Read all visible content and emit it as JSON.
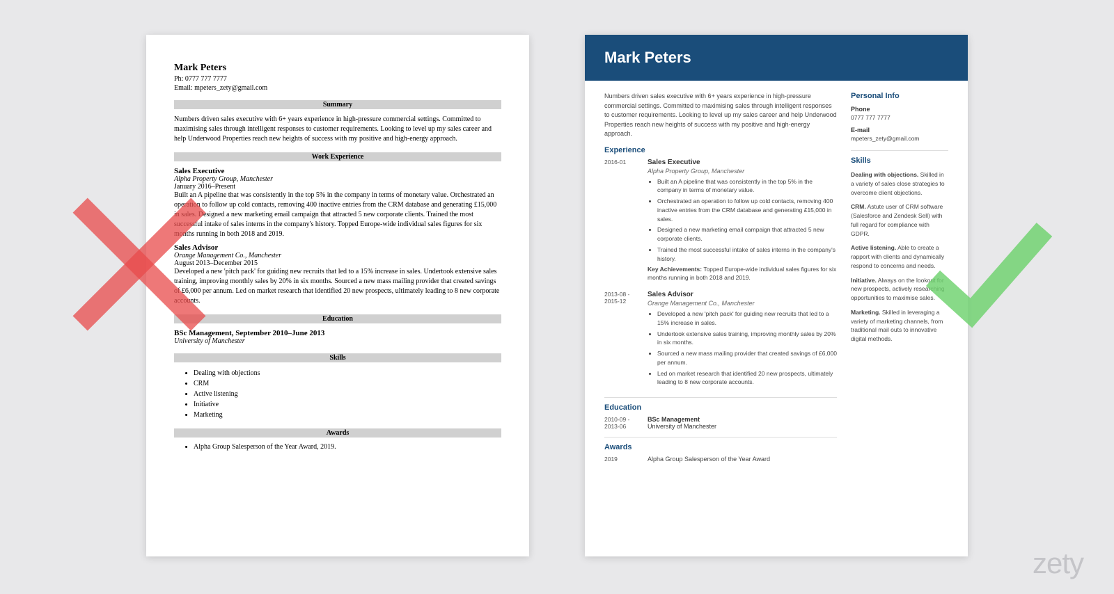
{
  "left": {
    "name": "Mark Peters",
    "phone_label": "Ph: 0777 777 7777",
    "email_label": "Email: mpeters_zety@gmail.com",
    "sections": {
      "summary": "Summary",
      "work": "Work Experience",
      "education": "Education",
      "skills": "Skills",
      "awards": "Awards"
    },
    "summary_text": "Numbers driven sales executive with 6+ years experience in high-pressure commercial settings. Committed to maximising sales through intelligent responses to customer requirements. Looking to level up my sales career and help Underwood Properties reach new heights of success with my positive and high-energy approach.",
    "jobs": [
      {
        "title": "Sales Executive",
        "company": "Alpha Property Group, Manchester",
        "dates": "January 2016–Present",
        "body": "Built an A pipeline that was consistently in the top 5% in the company in terms of monetary value. Orchestrated an operation to follow up cold contacts, removing 400 inactive entries from the CRM database and generating £15,000 in sales. Designed a new marketing email campaign that attracted 5 new corporate clients. Trained the most successful intake of sales interns in the company's history. Topped Europe-wide individual sales figures for six months running in both 2018 and 2019."
      },
      {
        "title": "Sales Advisor",
        "company": "Orange Management Co., Manchester",
        "dates": "August 2013–December 2015",
        "body": "Developed a new 'pitch pack' for guiding new recruits that led to a 15% increase in sales. Undertook extensive sales training, improving monthly sales by 20% in six months. Sourced a new mass mailing provider that created savings of £6,000 per annum. Led on market research that identified 20 new prospects, ultimately leading to 8 new corporate accounts."
      }
    ],
    "education": {
      "title": "BSc Management, September 2010–June 2013",
      "university": "University of Manchester"
    },
    "skills": [
      "Dealing with objections",
      "CRM",
      "Active listening",
      "Initiative",
      "Marketing"
    ],
    "awards": [
      "Alpha Group Salesperson of the Year Award, 2019."
    ]
  },
  "right": {
    "name": "Mark Peters",
    "summary": "Numbers driven sales executive with 6+ years experience in high-pressure commercial settings. Committed to maximising sales through intelligent responses to customer requirements. Looking to level up my sales career and help Underwood Properties reach new heights of success with my positive and high-energy approach.",
    "sections": {
      "experience": "Experience",
      "education": "Education",
      "awards": "Awards",
      "personal": "Personal Info",
      "skills": "Skills"
    },
    "experience": [
      {
        "date": "2016-01",
        "title": "Sales Executive",
        "company": "Alpha Property Group, Manchester",
        "bullets": [
          "Built an A pipeline that was consistently in the top 5% in the company in terms of monetary value.",
          "Orchestrated an operation to follow up cold contacts, removing 400 inactive entries from the CRM database and generating £15,000 in sales.",
          "Designed a new marketing email campaign that attracted 5 new corporate clients.",
          "Trained the most successful intake of sales interns in the company's history."
        ],
        "key_label": "Key Achievements:",
        "key_text": " Topped Europe-wide individual sales figures for six months running in both 2018 and 2019."
      },
      {
        "date": "2013-08 - 2015-12",
        "title": "Sales Advisor",
        "company": "Orange Management Co., Manchester",
        "bullets": [
          "Developed a new 'pitch pack' for guiding new recruits that led to a 15% increase in sales.",
          "Undertook extensive sales training, improving monthly sales by 20% in six months.",
          "Sourced a new mass mailing provider that created savings of £6,000 per annum.",
          "Led on market research that identified 20 new prospects, ultimately leading to 8 new corporate accounts."
        ]
      }
    ],
    "education": {
      "date": "2010-09 - 2013-06",
      "degree": "BSc Management",
      "university": "University of Manchester"
    },
    "awards": {
      "date": "2019",
      "text": "Alpha Group Salesperson of the Year Award"
    },
    "personal": {
      "phone_label": "Phone",
      "phone": "0777 777 7777",
      "email_label": "E-mail",
      "email": "mpeters_zety@gmail.com"
    },
    "skills": [
      {
        "title": "Dealing with objections.",
        "body": " Skilled in a variety of sales close strategies to overcome client objections."
      },
      {
        "title": "CRM.",
        "body": " Astute user of CRM software (Salesforce and Zendesk Sell) with full regard for compliance with GDPR."
      },
      {
        "title": "Active listening.",
        "body": " Able to create a rapport with clients and dynamically respond to concerns and needs."
      },
      {
        "title": "Initiative.",
        "body": " Always on the lookout for new prospects, actively researching opportunities to maximise sales."
      },
      {
        "title": "Marketing.",
        "body": " Skilled in leveraging a variety of marketing channels, from traditional mail outs to innovative digital methods."
      }
    ]
  },
  "watermark": "zety"
}
